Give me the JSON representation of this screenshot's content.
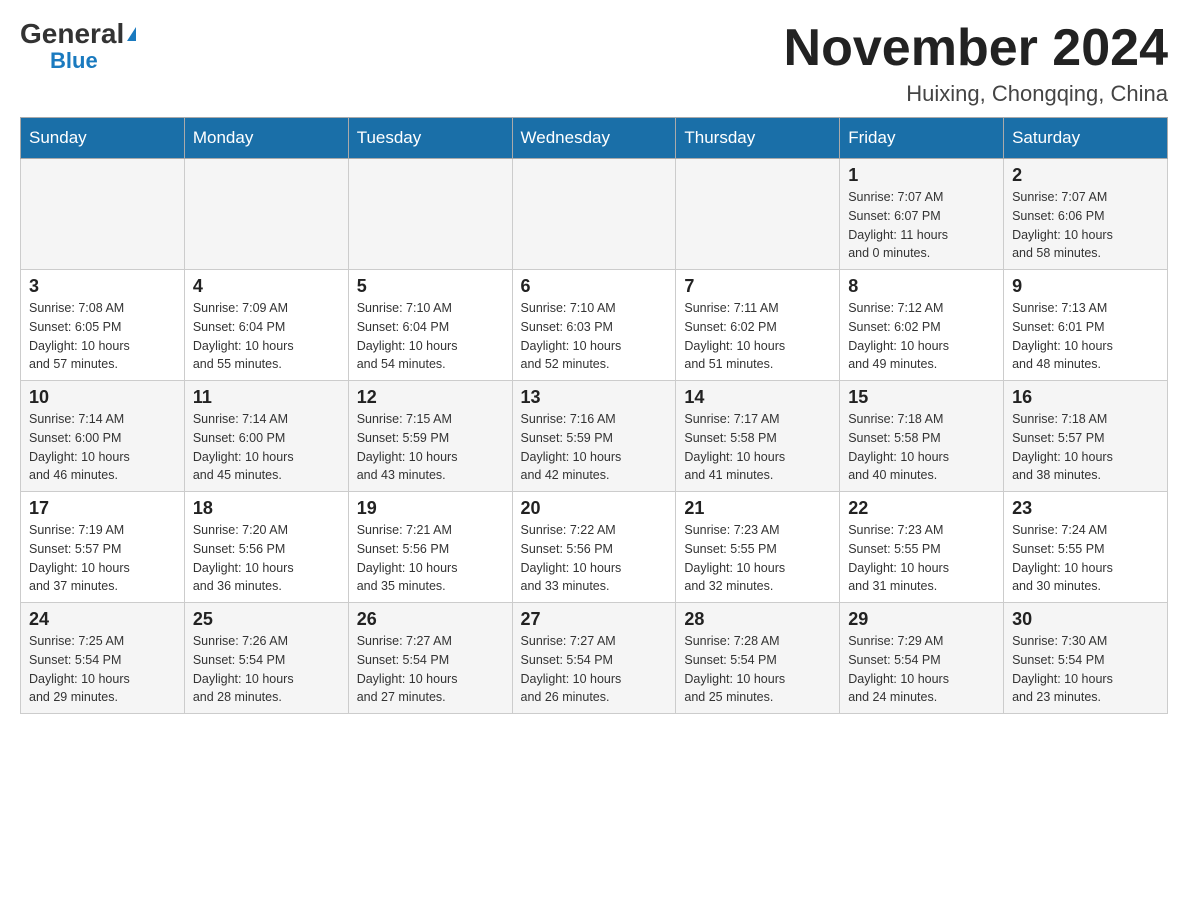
{
  "header": {
    "logo_general": "General",
    "logo_blue": "Blue",
    "month_year": "November 2024",
    "location": "Huixing, Chongqing, China"
  },
  "weekdays": [
    "Sunday",
    "Monday",
    "Tuesday",
    "Wednesday",
    "Thursday",
    "Friday",
    "Saturday"
  ],
  "rows": [
    {
      "cells": [
        {
          "day": "",
          "info": ""
        },
        {
          "day": "",
          "info": ""
        },
        {
          "day": "",
          "info": ""
        },
        {
          "day": "",
          "info": ""
        },
        {
          "day": "",
          "info": ""
        },
        {
          "day": "1",
          "info": "Sunrise: 7:07 AM\nSunset: 6:07 PM\nDaylight: 11 hours\nand 0 minutes."
        },
        {
          "day": "2",
          "info": "Sunrise: 7:07 AM\nSunset: 6:06 PM\nDaylight: 10 hours\nand 58 minutes."
        }
      ]
    },
    {
      "cells": [
        {
          "day": "3",
          "info": "Sunrise: 7:08 AM\nSunset: 6:05 PM\nDaylight: 10 hours\nand 57 minutes."
        },
        {
          "day": "4",
          "info": "Sunrise: 7:09 AM\nSunset: 6:04 PM\nDaylight: 10 hours\nand 55 minutes."
        },
        {
          "day": "5",
          "info": "Sunrise: 7:10 AM\nSunset: 6:04 PM\nDaylight: 10 hours\nand 54 minutes."
        },
        {
          "day": "6",
          "info": "Sunrise: 7:10 AM\nSunset: 6:03 PM\nDaylight: 10 hours\nand 52 minutes."
        },
        {
          "day": "7",
          "info": "Sunrise: 7:11 AM\nSunset: 6:02 PM\nDaylight: 10 hours\nand 51 minutes."
        },
        {
          "day": "8",
          "info": "Sunrise: 7:12 AM\nSunset: 6:02 PM\nDaylight: 10 hours\nand 49 minutes."
        },
        {
          "day": "9",
          "info": "Sunrise: 7:13 AM\nSunset: 6:01 PM\nDaylight: 10 hours\nand 48 minutes."
        }
      ]
    },
    {
      "cells": [
        {
          "day": "10",
          "info": "Sunrise: 7:14 AM\nSunset: 6:00 PM\nDaylight: 10 hours\nand 46 minutes."
        },
        {
          "day": "11",
          "info": "Sunrise: 7:14 AM\nSunset: 6:00 PM\nDaylight: 10 hours\nand 45 minutes."
        },
        {
          "day": "12",
          "info": "Sunrise: 7:15 AM\nSunset: 5:59 PM\nDaylight: 10 hours\nand 43 minutes."
        },
        {
          "day": "13",
          "info": "Sunrise: 7:16 AM\nSunset: 5:59 PM\nDaylight: 10 hours\nand 42 minutes."
        },
        {
          "day": "14",
          "info": "Sunrise: 7:17 AM\nSunset: 5:58 PM\nDaylight: 10 hours\nand 41 minutes."
        },
        {
          "day": "15",
          "info": "Sunrise: 7:18 AM\nSunset: 5:58 PM\nDaylight: 10 hours\nand 40 minutes."
        },
        {
          "day": "16",
          "info": "Sunrise: 7:18 AM\nSunset: 5:57 PM\nDaylight: 10 hours\nand 38 minutes."
        }
      ]
    },
    {
      "cells": [
        {
          "day": "17",
          "info": "Sunrise: 7:19 AM\nSunset: 5:57 PM\nDaylight: 10 hours\nand 37 minutes."
        },
        {
          "day": "18",
          "info": "Sunrise: 7:20 AM\nSunset: 5:56 PM\nDaylight: 10 hours\nand 36 minutes."
        },
        {
          "day": "19",
          "info": "Sunrise: 7:21 AM\nSunset: 5:56 PM\nDaylight: 10 hours\nand 35 minutes."
        },
        {
          "day": "20",
          "info": "Sunrise: 7:22 AM\nSunset: 5:56 PM\nDaylight: 10 hours\nand 33 minutes."
        },
        {
          "day": "21",
          "info": "Sunrise: 7:23 AM\nSunset: 5:55 PM\nDaylight: 10 hours\nand 32 minutes."
        },
        {
          "day": "22",
          "info": "Sunrise: 7:23 AM\nSunset: 5:55 PM\nDaylight: 10 hours\nand 31 minutes."
        },
        {
          "day": "23",
          "info": "Sunrise: 7:24 AM\nSunset: 5:55 PM\nDaylight: 10 hours\nand 30 minutes."
        }
      ]
    },
    {
      "cells": [
        {
          "day": "24",
          "info": "Sunrise: 7:25 AM\nSunset: 5:54 PM\nDaylight: 10 hours\nand 29 minutes."
        },
        {
          "day": "25",
          "info": "Sunrise: 7:26 AM\nSunset: 5:54 PM\nDaylight: 10 hours\nand 28 minutes."
        },
        {
          "day": "26",
          "info": "Sunrise: 7:27 AM\nSunset: 5:54 PM\nDaylight: 10 hours\nand 27 minutes."
        },
        {
          "day": "27",
          "info": "Sunrise: 7:27 AM\nSunset: 5:54 PM\nDaylight: 10 hours\nand 26 minutes."
        },
        {
          "day": "28",
          "info": "Sunrise: 7:28 AM\nSunset: 5:54 PM\nDaylight: 10 hours\nand 25 minutes."
        },
        {
          "day": "29",
          "info": "Sunrise: 7:29 AM\nSunset: 5:54 PM\nDaylight: 10 hours\nand 24 minutes."
        },
        {
          "day": "30",
          "info": "Sunrise: 7:30 AM\nSunset: 5:54 PM\nDaylight: 10 hours\nand 23 minutes."
        }
      ]
    }
  ]
}
